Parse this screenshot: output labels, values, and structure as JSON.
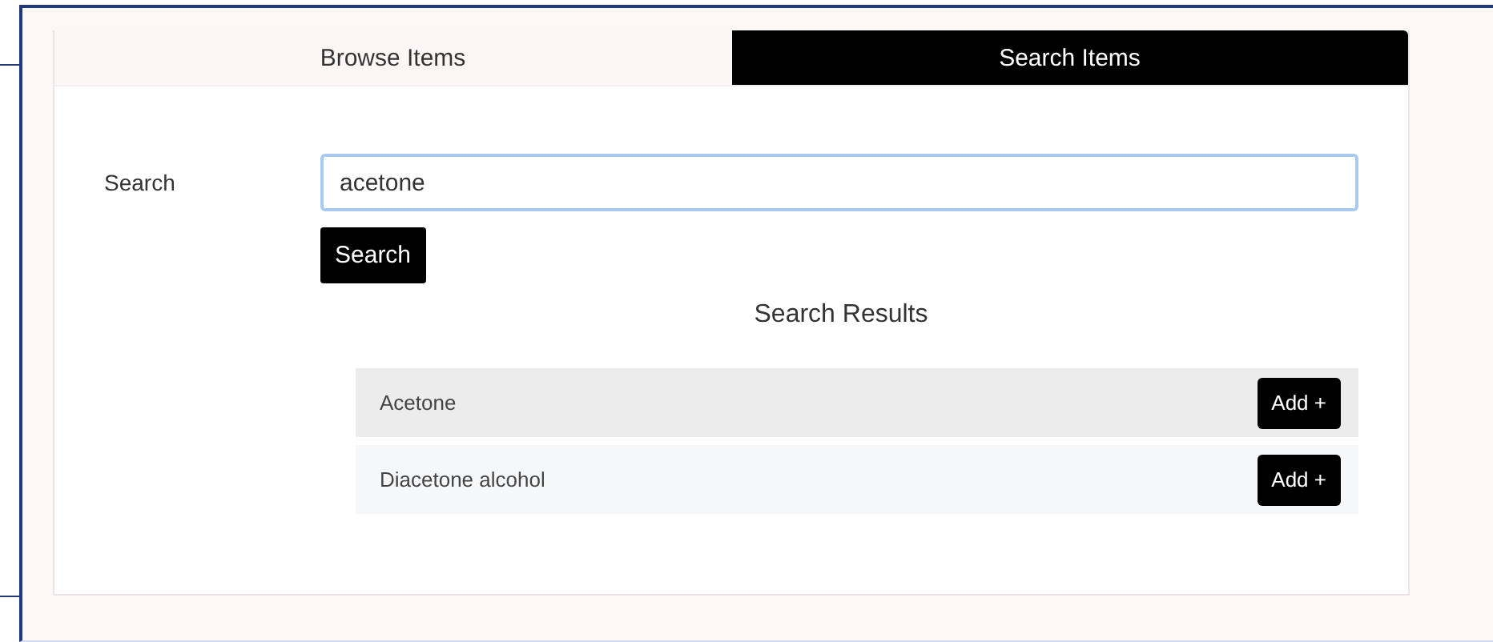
{
  "tabs": [
    {
      "label": "Browse Items",
      "selected": false
    },
    {
      "label": "Search Items",
      "selected": true
    }
  ],
  "search": {
    "label": "Search",
    "value": "acetone",
    "button": "Search"
  },
  "results": {
    "title": "Search Results",
    "items": [
      {
        "name": "Acetone",
        "button": "Add +"
      },
      {
        "name": "Diacetone alcohol",
        "button": "Add +"
      }
    ]
  }
}
